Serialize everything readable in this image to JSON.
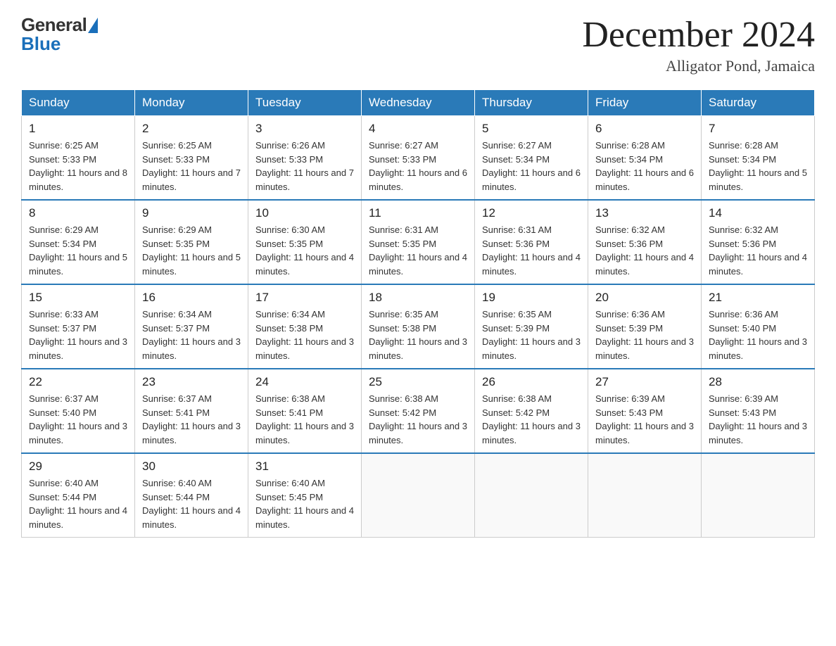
{
  "header": {
    "logo_general": "General",
    "logo_blue": "Blue",
    "month_title": "December 2024",
    "location": "Alligator Pond, Jamaica"
  },
  "days_of_week": [
    "Sunday",
    "Monday",
    "Tuesday",
    "Wednesday",
    "Thursday",
    "Friday",
    "Saturday"
  ],
  "weeks": [
    [
      {
        "day": "1",
        "sunrise": "6:25 AM",
        "sunset": "5:33 PM",
        "daylight": "11 hours and 8 minutes."
      },
      {
        "day": "2",
        "sunrise": "6:25 AM",
        "sunset": "5:33 PM",
        "daylight": "11 hours and 7 minutes."
      },
      {
        "day": "3",
        "sunrise": "6:26 AM",
        "sunset": "5:33 PM",
        "daylight": "11 hours and 7 minutes."
      },
      {
        "day": "4",
        "sunrise": "6:27 AM",
        "sunset": "5:33 PM",
        "daylight": "11 hours and 6 minutes."
      },
      {
        "day": "5",
        "sunrise": "6:27 AM",
        "sunset": "5:34 PM",
        "daylight": "11 hours and 6 minutes."
      },
      {
        "day": "6",
        "sunrise": "6:28 AM",
        "sunset": "5:34 PM",
        "daylight": "11 hours and 6 minutes."
      },
      {
        "day": "7",
        "sunrise": "6:28 AM",
        "sunset": "5:34 PM",
        "daylight": "11 hours and 5 minutes."
      }
    ],
    [
      {
        "day": "8",
        "sunrise": "6:29 AM",
        "sunset": "5:34 PM",
        "daylight": "11 hours and 5 minutes."
      },
      {
        "day": "9",
        "sunrise": "6:29 AM",
        "sunset": "5:35 PM",
        "daylight": "11 hours and 5 minutes."
      },
      {
        "day": "10",
        "sunrise": "6:30 AM",
        "sunset": "5:35 PM",
        "daylight": "11 hours and 4 minutes."
      },
      {
        "day": "11",
        "sunrise": "6:31 AM",
        "sunset": "5:35 PM",
        "daylight": "11 hours and 4 minutes."
      },
      {
        "day": "12",
        "sunrise": "6:31 AM",
        "sunset": "5:36 PM",
        "daylight": "11 hours and 4 minutes."
      },
      {
        "day": "13",
        "sunrise": "6:32 AM",
        "sunset": "5:36 PM",
        "daylight": "11 hours and 4 minutes."
      },
      {
        "day": "14",
        "sunrise": "6:32 AM",
        "sunset": "5:36 PM",
        "daylight": "11 hours and 4 minutes."
      }
    ],
    [
      {
        "day": "15",
        "sunrise": "6:33 AM",
        "sunset": "5:37 PM",
        "daylight": "11 hours and 3 minutes."
      },
      {
        "day": "16",
        "sunrise": "6:34 AM",
        "sunset": "5:37 PM",
        "daylight": "11 hours and 3 minutes."
      },
      {
        "day": "17",
        "sunrise": "6:34 AM",
        "sunset": "5:38 PM",
        "daylight": "11 hours and 3 minutes."
      },
      {
        "day": "18",
        "sunrise": "6:35 AM",
        "sunset": "5:38 PM",
        "daylight": "11 hours and 3 minutes."
      },
      {
        "day": "19",
        "sunrise": "6:35 AM",
        "sunset": "5:39 PM",
        "daylight": "11 hours and 3 minutes."
      },
      {
        "day": "20",
        "sunrise": "6:36 AM",
        "sunset": "5:39 PM",
        "daylight": "11 hours and 3 minutes."
      },
      {
        "day": "21",
        "sunrise": "6:36 AM",
        "sunset": "5:40 PM",
        "daylight": "11 hours and 3 minutes."
      }
    ],
    [
      {
        "day": "22",
        "sunrise": "6:37 AM",
        "sunset": "5:40 PM",
        "daylight": "11 hours and 3 minutes."
      },
      {
        "day": "23",
        "sunrise": "6:37 AM",
        "sunset": "5:41 PM",
        "daylight": "11 hours and 3 minutes."
      },
      {
        "day": "24",
        "sunrise": "6:38 AM",
        "sunset": "5:41 PM",
        "daylight": "11 hours and 3 minutes."
      },
      {
        "day": "25",
        "sunrise": "6:38 AM",
        "sunset": "5:42 PM",
        "daylight": "11 hours and 3 minutes."
      },
      {
        "day": "26",
        "sunrise": "6:38 AM",
        "sunset": "5:42 PM",
        "daylight": "11 hours and 3 minutes."
      },
      {
        "day": "27",
        "sunrise": "6:39 AM",
        "sunset": "5:43 PM",
        "daylight": "11 hours and 3 minutes."
      },
      {
        "day": "28",
        "sunrise": "6:39 AM",
        "sunset": "5:43 PM",
        "daylight": "11 hours and 3 minutes."
      }
    ],
    [
      {
        "day": "29",
        "sunrise": "6:40 AM",
        "sunset": "5:44 PM",
        "daylight": "11 hours and 4 minutes."
      },
      {
        "day": "30",
        "sunrise": "6:40 AM",
        "sunset": "5:44 PM",
        "daylight": "11 hours and 4 minutes."
      },
      {
        "day": "31",
        "sunrise": "6:40 AM",
        "sunset": "5:45 PM",
        "daylight": "11 hours and 4 minutes."
      },
      null,
      null,
      null,
      null
    ]
  ],
  "labels": {
    "sunrise_prefix": "Sunrise: ",
    "sunset_prefix": "Sunset: ",
    "daylight_prefix": "Daylight: "
  }
}
